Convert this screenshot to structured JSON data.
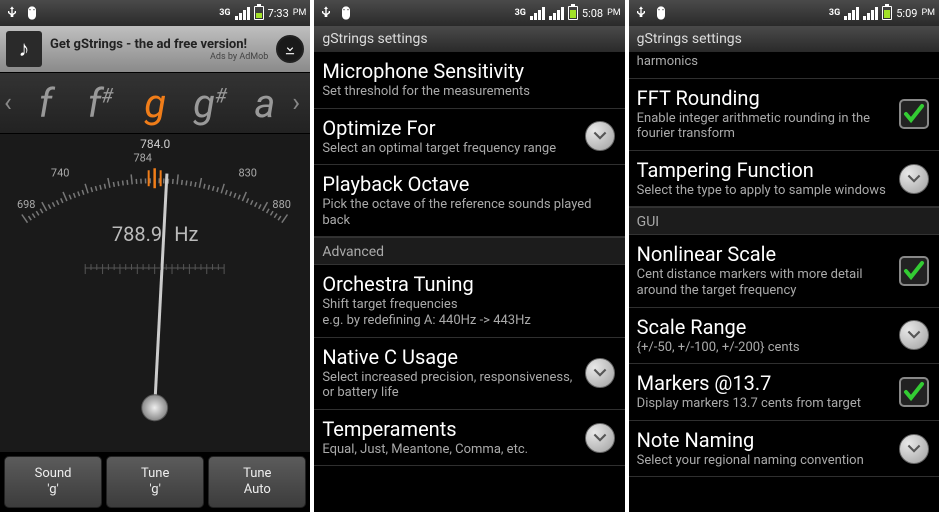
{
  "screen1": {
    "status": {
      "time": "7:33",
      "ampm": "PM",
      "threeg": "3G",
      "battery_pct": 40,
      "charging": false
    },
    "ad": {
      "title": "Get gStrings - the ad free version!",
      "by": "Ads by AdMob"
    },
    "notes": [
      {
        "label": "f",
        "sharp": false,
        "selected": false
      },
      {
        "label": "f",
        "sharp": true,
        "selected": false
      },
      {
        "label": "g",
        "sharp": false,
        "selected": true
      },
      {
        "label": "g",
        "sharp": true,
        "selected": false
      },
      {
        "label": "a",
        "sharp": false,
        "selected": false
      }
    ],
    "gauge": {
      "target": "784.0",
      "current": "788.9",
      "hz_suffix": "Hz",
      "ticks": [
        "698",
        "740",
        "784",
        "830",
        "880"
      ]
    },
    "buttons": [
      {
        "label": "Sound\n'g'"
      },
      {
        "label": "Tune\n'g'"
      },
      {
        "label": "Tune\nAuto"
      }
    ]
  },
  "screen2": {
    "status": {
      "time": "5:08",
      "ampm": "PM",
      "threeg": "3G",
      "battery_pct": 65,
      "charging": true
    },
    "title": "gStrings settings",
    "items": [
      {
        "title": "Microphone Sensitivity",
        "sub": "Set threshold for the measurements",
        "kind": "none"
      },
      {
        "title": "Optimize For",
        "sub": "Select an optimal target frequency range",
        "kind": "circle"
      },
      {
        "title": "Playback Octave",
        "sub": "Pick the octave of the reference sounds played back",
        "kind": "none"
      }
    ],
    "section": "Advanced",
    "items2": [
      {
        "title": "Orchestra Tuning",
        "sub": "Shift target frequencies\ne.g. by redefining A: 440Hz -> 443Hz",
        "kind": "none"
      },
      {
        "title": "Native C Usage",
        "sub": "Select increased precision, responsiveness, or battery life",
        "kind": "circle"
      },
      {
        "title": "Temperaments",
        "sub": "Equal, Just, Meantone, Comma, etc.",
        "kind": "circle"
      }
    ]
  },
  "screen3": {
    "status": {
      "time": "5:09",
      "ampm": "PM",
      "threeg": "3G",
      "battery_pct": 65,
      "charging": true
    },
    "title": "gStrings settings",
    "partial_sub": "harmonics",
    "items": [
      {
        "title": "FFT Rounding",
        "sub": "Enable integer arithmetic rounding in the fourier transform",
        "kind": "check",
        "checked": true
      },
      {
        "title": "Tampering Function",
        "sub": "Select the type to apply to sample windows",
        "kind": "circle"
      }
    ],
    "section": "GUI",
    "items2": [
      {
        "title": "Nonlinear Scale",
        "sub": "Cent distance markers with more detail around the target frequency",
        "kind": "check",
        "checked": true
      },
      {
        "title": "Scale Range",
        "sub": "{+/-50, +/-100, +/-200} cents",
        "kind": "circle"
      },
      {
        "title": "Markers @13.7",
        "sub": "Display markers 13.7 cents from target",
        "kind": "check",
        "checked": true
      },
      {
        "title": "Note Naming",
        "sub": "Select your regional naming convention",
        "kind": "circle"
      }
    ]
  }
}
